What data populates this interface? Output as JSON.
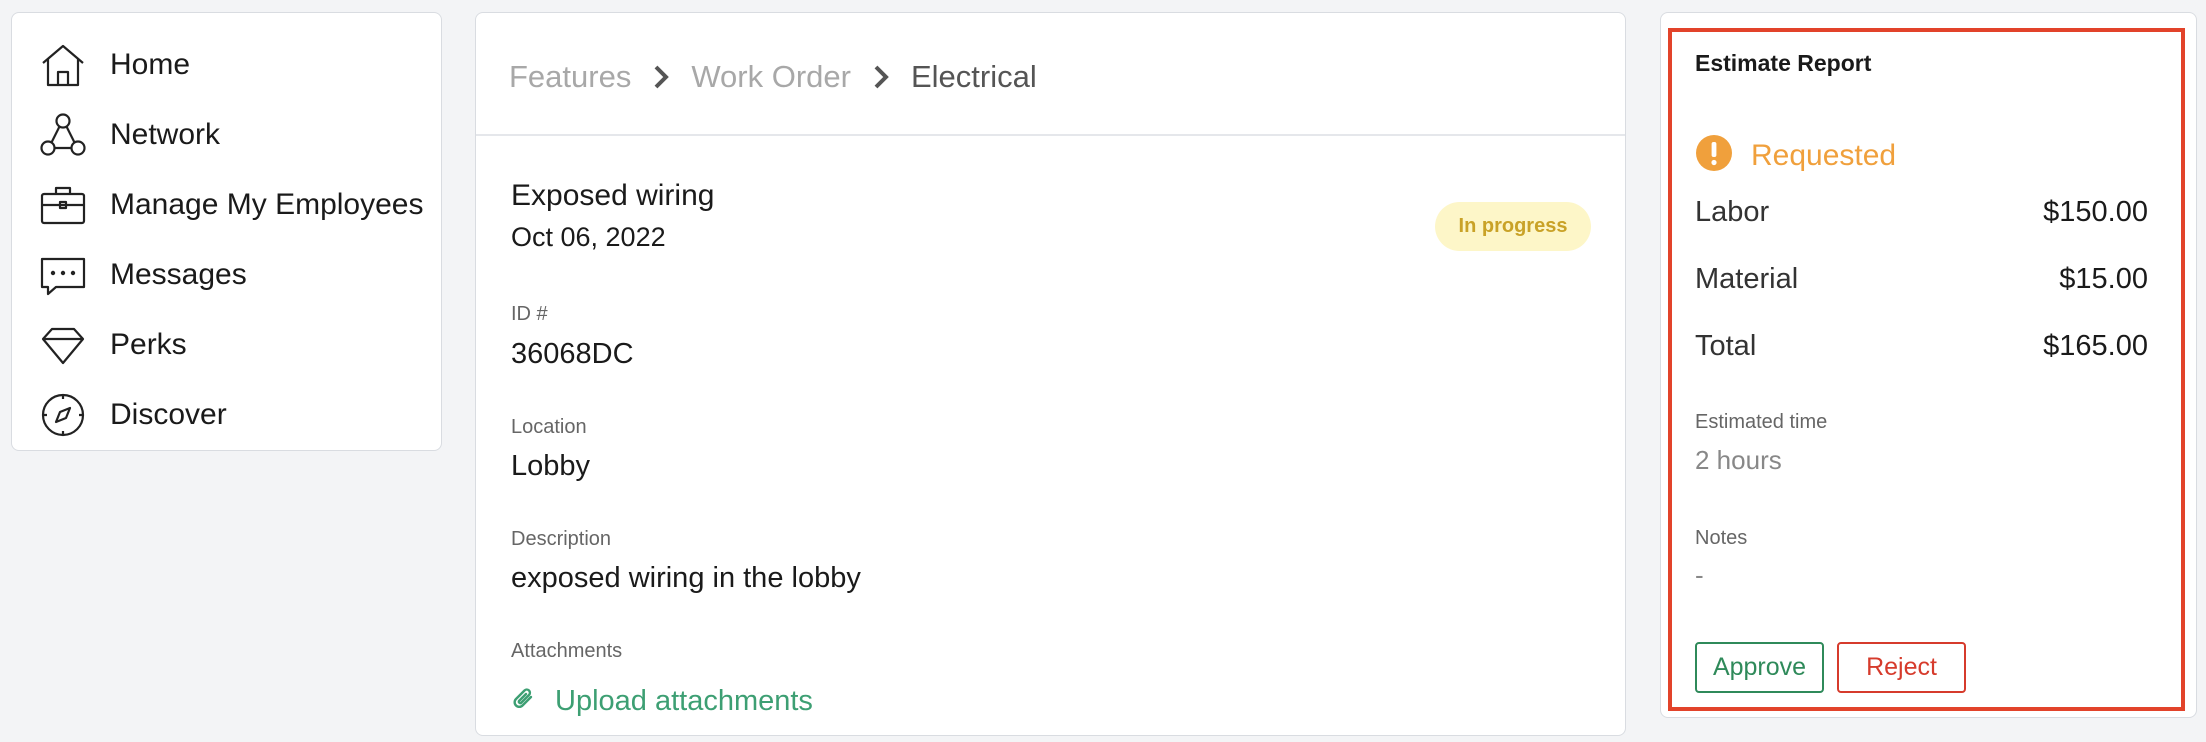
{
  "sidebar": {
    "items": [
      {
        "label": "Home",
        "icon": "home-icon"
      },
      {
        "label": "Network",
        "icon": "network-icon"
      },
      {
        "label": "Manage My Employees",
        "icon": "briefcase-icon"
      },
      {
        "label": "Messages",
        "icon": "message-icon"
      },
      {
        "label": "Perks",
        "icon": "diamond-icon"
      },
      {
        "label": "Discover",
        "icon": "compass-icon"
      }
    ]
  },
  "breadcrumb": {
    "items": [
      "Features",
      "Work Order",
      "Electrical"
    ]
  },
  "work_order": {
    "title": "Exposed wiring",
    "date": "Oct 06, 2022",
    "status": "In progress",
    "id_label": "ID #",
    "id_value": "36068DC",
    "location_label": "Location",
    "location_value": "Lobby",
    "description_label": "Description",
    "description_value": "exposed wiring in the lobby",
    "attachments_label": "Attachments",
    "upload_label": "Upload attachments"
  },
  "estimate": {
    "title": "Estimate Report",
    "status": "Requested",
    "rows": [
      {
        "label": "Labor",
        "value": "$150.00"
      },
      {
        "label": "Material",
        "value": "$15.00"
      },
      {
        "label": "Total",
        "value": "$165.00"
      }
    ],
    "time_label": "Estimated time",
    "time_value": "2 hours",
    "notes_label": "Notes",
    "notes_value": "-",
    "approve_label": "Approve",
    "reject_label": "Reject"
  },
  "colors": {
    "status_in_progress_bg": "#fdf6c8",
    "status_in_progress_text": "#c9a227",
    "requested": "#f0a03c",
    "link_green": "#3d9f73",
    "approve": "#2f8a5a",
    "reject": "#d63b2c",
    "highlight_border": "#e2432a"
  }
}
